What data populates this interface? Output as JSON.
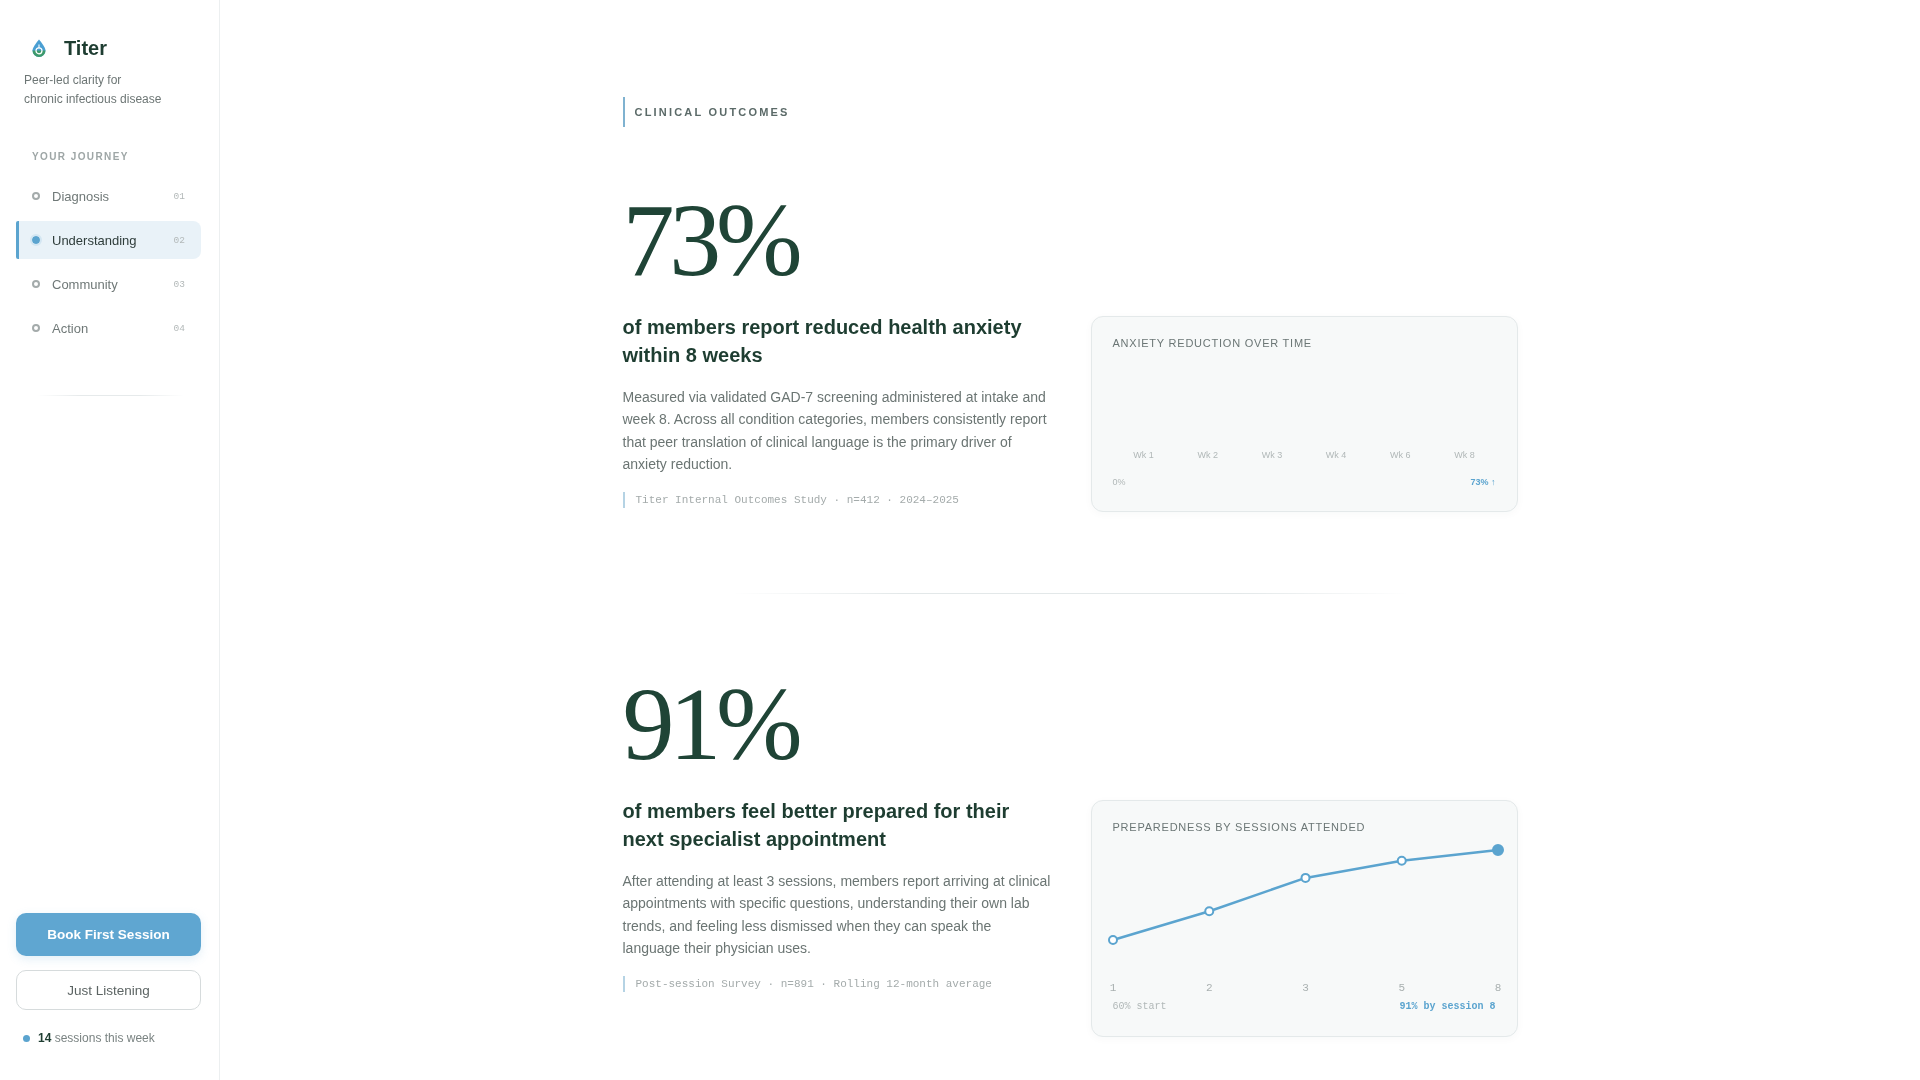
{
  "sidebar": {
    "brand": {
      "name": "Titer",
      "tagline": "Peer-led clarity for chronic infectious disease"
    },
    "nav": {
      "heading": "YOUR JOURNEY",
      "items": [
        {
          "label": "Diagnosis",
          "number": "01",
          "selected": false
        },
        {
          "label": "Understanding",
          "number": "02",
          "selected": true
        },
        {
          "label": "Community",
          "number": "03",
          "selected": false
        },
        {
          "label": "Action",
          "number": "04",
          "selected": false
        }
      ]
    },
    "actions": [
      {
        "label": "Book First Session",
        "kind": "primary"
      },
      {
        "label": "Just Listening",
        "kind": "secondary"
      }
    ],
    "activity": "**14** sessions this week"
  },
  "main": {
    "section_label": "CLINICAL OUTCOMES",
    "stats": [
      {
        "figure": "73%",
        "headline": "of members report reduced health anxiety within 8 weeks",
        "description": "Measured via validated GAD-7 screening administered at intake and week 8. Across all condition categories, members consistently report that peer translation of clinical language is the primary driver of anxiety reduction.",
        "source": "Titer Internal Outcomes Study · n=412 · 2024–2025",
        "panel": {
          "kind": "weekly",
          "title": "ANXIETY REDUCTION OVER TIME",
          "labels": [
            "Wk 1",
            "Wk 2",
            "Wk 3",
            "Wk 4",
            "Wk 6",
            "Wk 8"
          ],
          "start_label": "0%",
          "end_label": "73% ↑"
        }
      },
      {
        "figure": "91%",
        "headline": "of members feel better prepared for their next specialist appointment",
        "description": "After attending at least 3 sessions, members report arriving at clinical appointments with specific questions, understanding their own lab trends, and feeling less dismissed when they can speak the language their physician uses.",
        "source": "Post-session Survey · n=891 · Rolling 12-month average",
        "panel": {
          "kind": "trend",
          "title": "PREPAREDNESS BY SESSIONS ATTENDED",
          "labels": [
            "1",
            "2",
            "3",
            "5",
            "8"
          ],
          "start_label": "60% start",
          "end_label": "91% by session 8"
        }
      }
    ]
  }
}
